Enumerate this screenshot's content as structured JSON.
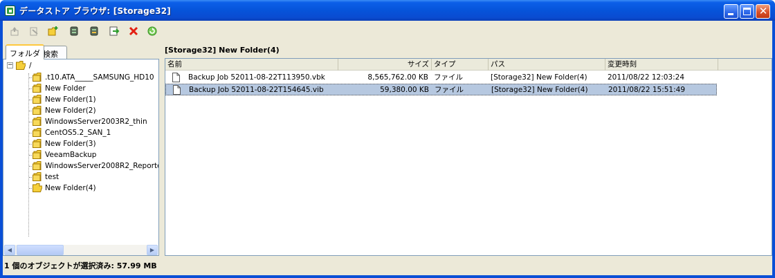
{
  "window": {
    "title": "データストア ブラウザ: [Storage32]"
  },
  "toolbar": {
    "buttons": [
      {
        "icon": "upload-icon",
        "enabled": false
      },
      {
        "icon": "download-icon",
        "enabled": false
      },
      {
        "icon": "new-folder-icon",
        "enabled": true
      },
      {
        "icon": "datastore-upload-icon",
        "enabled": true
      },
      {
        "icon": "datastore-download-icon",
        "enabled": true
      },
      {
        "icon": "move-icon",
        "enabled": true
      },
      {
        "icon": "delete-icon",
        "enabled": true
      },
      {
        "icon": "refresh-icon",
        "enabled": true
      }
    ]
  },
  "left_pane": {
    "tabs": [
      {
        "label": "フォルダ",
        "active": true
      },
      {
        "label": "検索",
        "active": false
      }
    ],
    "tree": {
      "root": "/",
      "folders": [
        ".t10.ATA_____SAMSUNG_HD10",
        "New Folder",
        "New Folder(1)",
        "New Folder(2)",
        "WindowsServer2003R2_thin",
        "CentOS5.2_SAN_1",
        "New Folder(3)",
        "VeeamBackup",
        "WindowsServer2008R2_Reporte",
        "test",
        "New Folder(4)"
      ],
      "selected": "New Folder(4)"
    }
  },
  "main": {
    "path": "[Storage32] New Folder(4)",
    "columns": [
      "名前",
      "サイズ",
      "タイプ",
      "パス",
      "変更時刻"
    ],
    "rows": [
      {
        "name": "Backup Job 52011-08-22T113950.vbk",
        "size": "8,565,762.00 KB",
        "type": "ファイル",
        "path": "[Storage32] New Folder(4)",
        "modified": "2011/08/22 12:03:24",
        "selected": false
      },
      {
        "name": "Backup Job 52011-08-22T154645.vib",
        "size": "59,380.00 KB",
        "type": "ファイル",
        "path": "[Storage32] New Folder(4)",
        "modified": "2011/08/22 15:51:49",
        "selected": true
      }
    ]
  },
  "status": {
    "text": "1 個のオブジェクトが選択済み: 57.99 MB"
  },
  "colors": {
    "titlebar": "#0654da",
    "client_bg": "#ece9d8",
    "selection": "#b6c8e0",
    "folder_yellow": "#f5cf3b"
  }
}
